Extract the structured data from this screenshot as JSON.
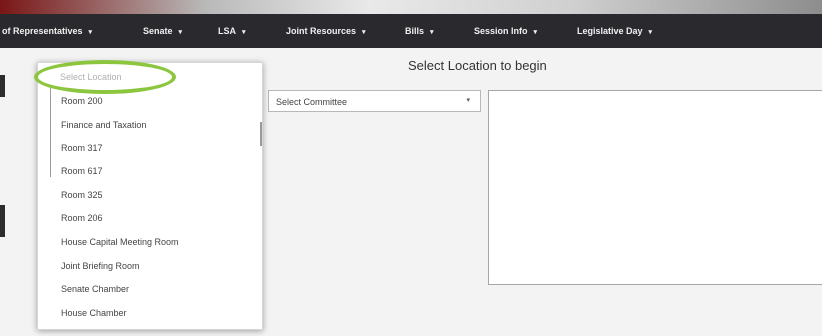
{
  "nav": {
    "items": [
      {
        "label": "of Representatives",
        "caret": "▾"
      },
      {
        "label": "Senate",
        "caret": "▾"
      },
      {
        "label": "LSA",
        "caret": "▾"
      },
      {
        "label": "Joint Resources",
        "caret": "▾"
      },
      {
        "label": "Bills",
        "caret": "▾"
      },
      {
        "label": "Session Info",
        "caret": "▾"
      },
      {
        "label": "Legislative Day",
        "caret": "▾"
      }
    ]
  },
  "main": {
    "title": "Select Location to begin",
    "committee_select": {
      "value": "Select Committee",
      "arrow": "▾"
    }
  },
  "location_dropdown": {
    "placeholder": "Select Location",
    "options": [
      "Room 200",
      "Finance and Taxation",
      "Room 317",
      "Room 617",
      "Room 325",
      "Room 206",
      "House Capital Meeting Room",
      "Joint Briefing Room",
      "Senate Chamber",
      "House Chamber"
    ]
  },
  "colors": {
    "navbar_bg": "#2a2a2e",
    "highlight_ring": "#8cc63f",
    "brand_red": "#7a1616"
  }
}
